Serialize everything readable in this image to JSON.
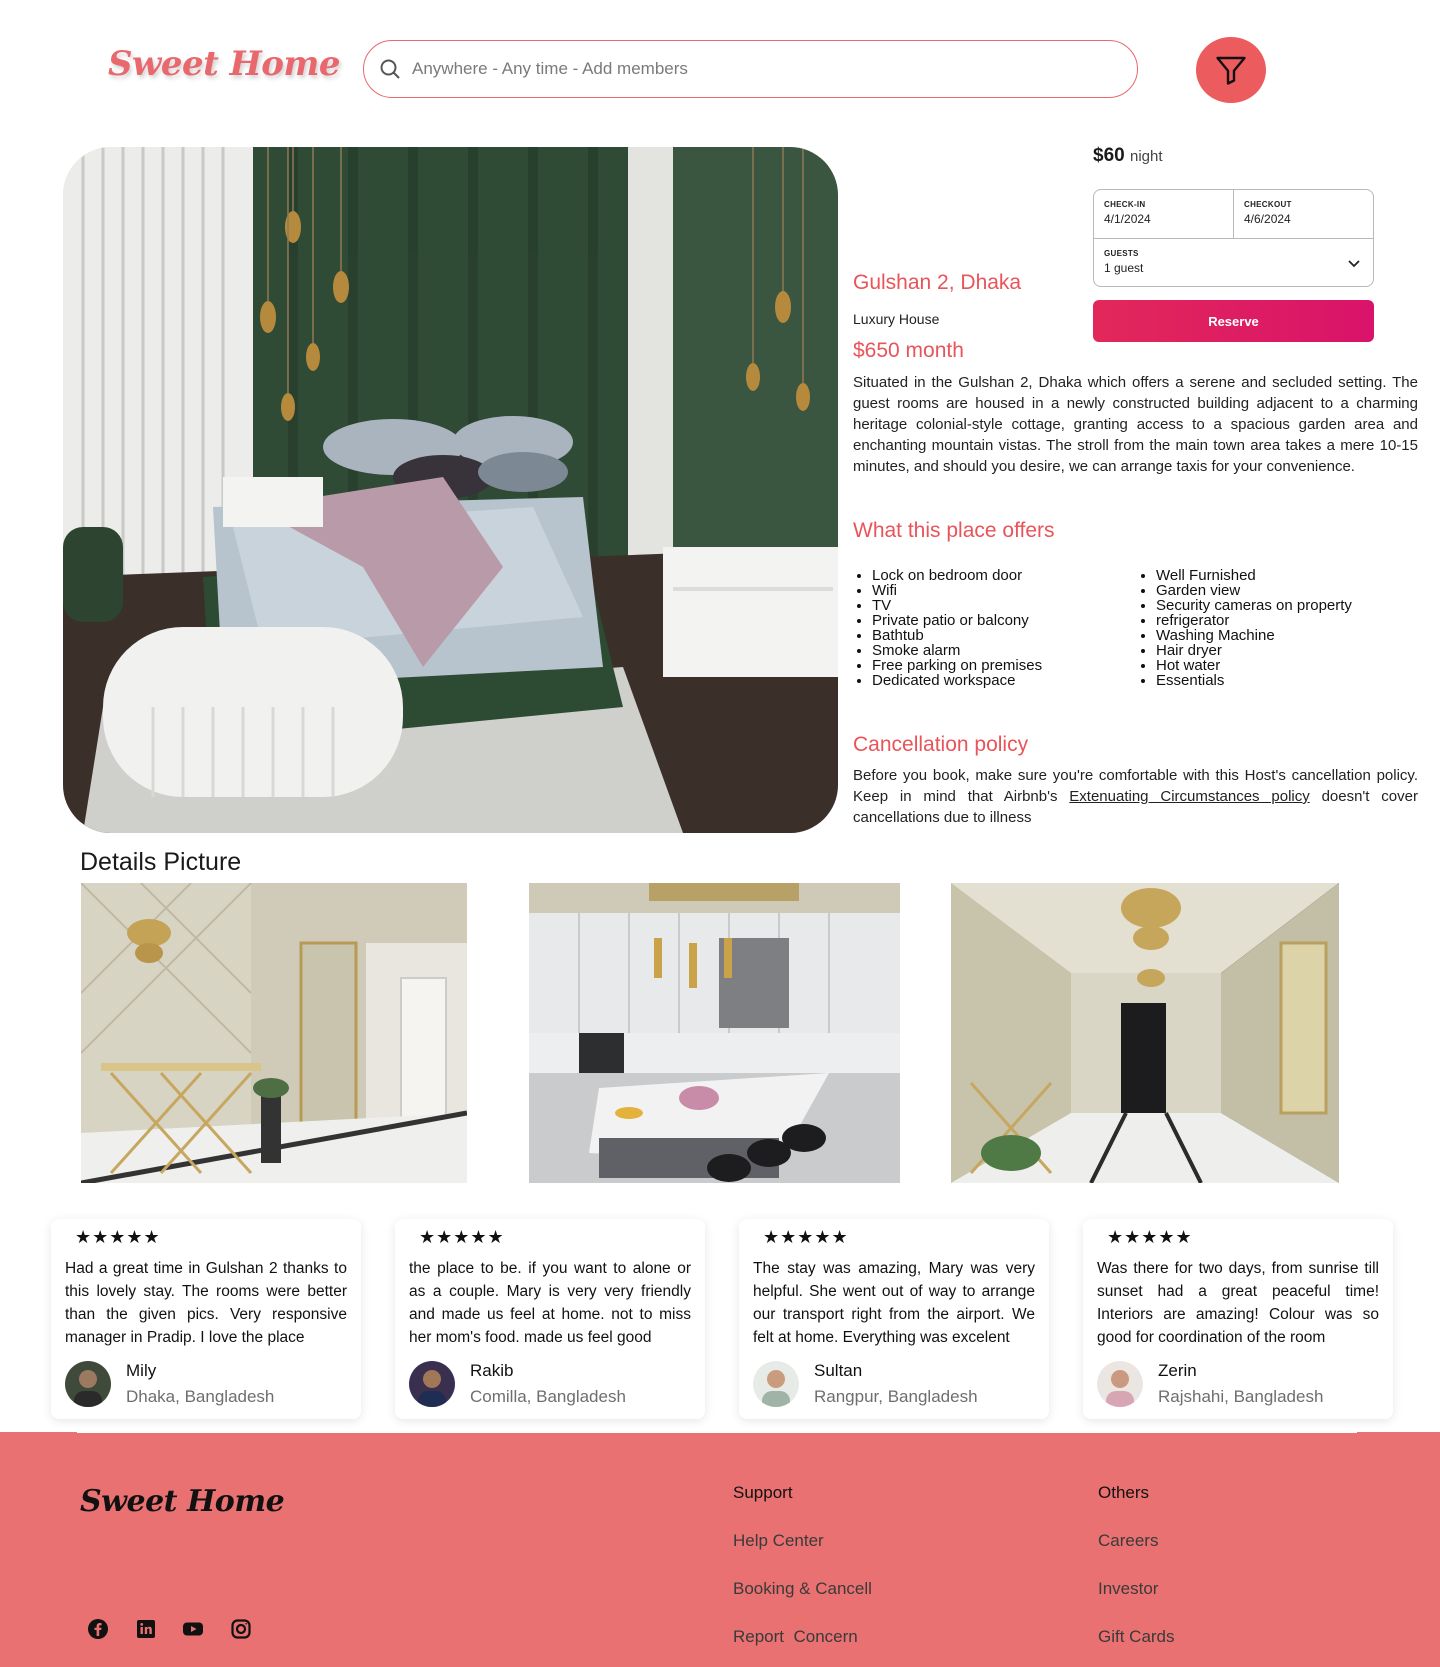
{
  "brand": {
    "name": "Sweet Home",
    "accent": "#e8686e",
    "footer_bg": "#ea7171"
  },
  "search": {
    "placeholder": "Anywhere - Any time - Add members",
    "icon": "search-icon"
  },
  "filter": {
    "icon": "filter-icon"
  },
  "booking": {
    "price": "$60",
    "unit": "night",
    "checkin_label": "CHECK-IN",
    "checkin_value": "4/1/2024",
    "checkout_label": "CHECKOUT",
    "checkout_value": "4/6/2024",
    "guests_label": "GUESTS",
    "guests_value": "1 guest",
    "reserve_label": "Reserve"
  },
  "listing": {
    "location": "Gulshan 2, Dhaka",
    "type": "Luxury House",
    "price_month": "$650 month",
    "description": "Situated in the Gulshan 2, Dhaka which offers a serene and secluded setting. The guest rooms are housed in a newly constructed building adjacent to a charming heritage colonial-style cottage, granting access to a spacious garden area and enchanting mountain vistas. The stroll from the main town area takes a mere 10-15 minutes, and should you desire, we can arrange taxis for your convenience."
  },
  "offers": {
    "title": "What this place offers",
    "left": [
      "Lock on bedroom door",
      "Wifi",
      "TV",
      "Private patio or balcony",
      "Bathtub",
      "Smoke alarm",
      "Free parking on premises",
      "Dedicated workspace"
    ],
    "right": [
      "Well Furnished",
      "Garden view",
      "Security cameras on property",
      "refrigerator",
      "Washing Machine",
      "Hair dryer",
      "Hot water",
      "Essentials"
    ]
  },
  "cancellation": {
    "title": "Cancellation policy",
    "text_before": "Before you book, make sure you're comfortable with this Host's cancellation policy. Keep in mind that Airbnb's ",
    "link": "Extenuating Circumstances policy",
    "text_after": " doesn't cover cancellations due to illness"
  },
  "details": {
    "title": "Details Picture"
  },
  "reviews": [
    {
      "stars": "★★★★★",
      "rating": 5,
      "text": "Had a great time in Gulshan 2 thanks to this lovely stay. The rooms were better than the given pics. Very responsive manager in Pradip. I love the place",
      "name": "Mily",
      "location": "Dhaka, Bangladesh"
    },
    {
      "stars": "★★★★★",
      "rating": 5,
      "text": "the place to be. if you want to alone or as a couple. Mary is very very friendly and made us feel at home. not to miss her mom's food. made us feel good",
      "name": "Rakib",
      "location": "Comilla, Bangladesh"
    },
    {
      "stars": "★★★★★",
      "rating": 5,
      "text": "The stay was amazing, Mary was very helpful. She went out of way to arrange our transport right from the airport. We felt at home. Everything was excelent",
      "name": "Sultan",
      "location": "Rangpur, Bangladesh"
    },
    {
      "stars": "★★★★★",
      "rating": 5,
      "text": "Was there for two days, from sunrise till sunset had a great peaceful time! Interiors are amazing! Colour was so good for coordination of the room",
      "name": "Zerin",
      "location": "Rajshahi, Bangladesh"
    }
  ],
  "footer": {
    "logo": "Sweet Home",
    "support": {
      "title": "Support",
      "links": [
        "Help Center",
        "Booking & Cancell",
        "Report  Concern"
      ]
    },
    "others": {
      "title": "Others",
      "links": [
        "Careers",
        "Investor",
        "Gift Cards"
      ]
    },
    "social": [
      "facebook-icon",
      "linkedin-icon",
      "youtube-icon",
      "instagram-icon"
    ]
  }
}
